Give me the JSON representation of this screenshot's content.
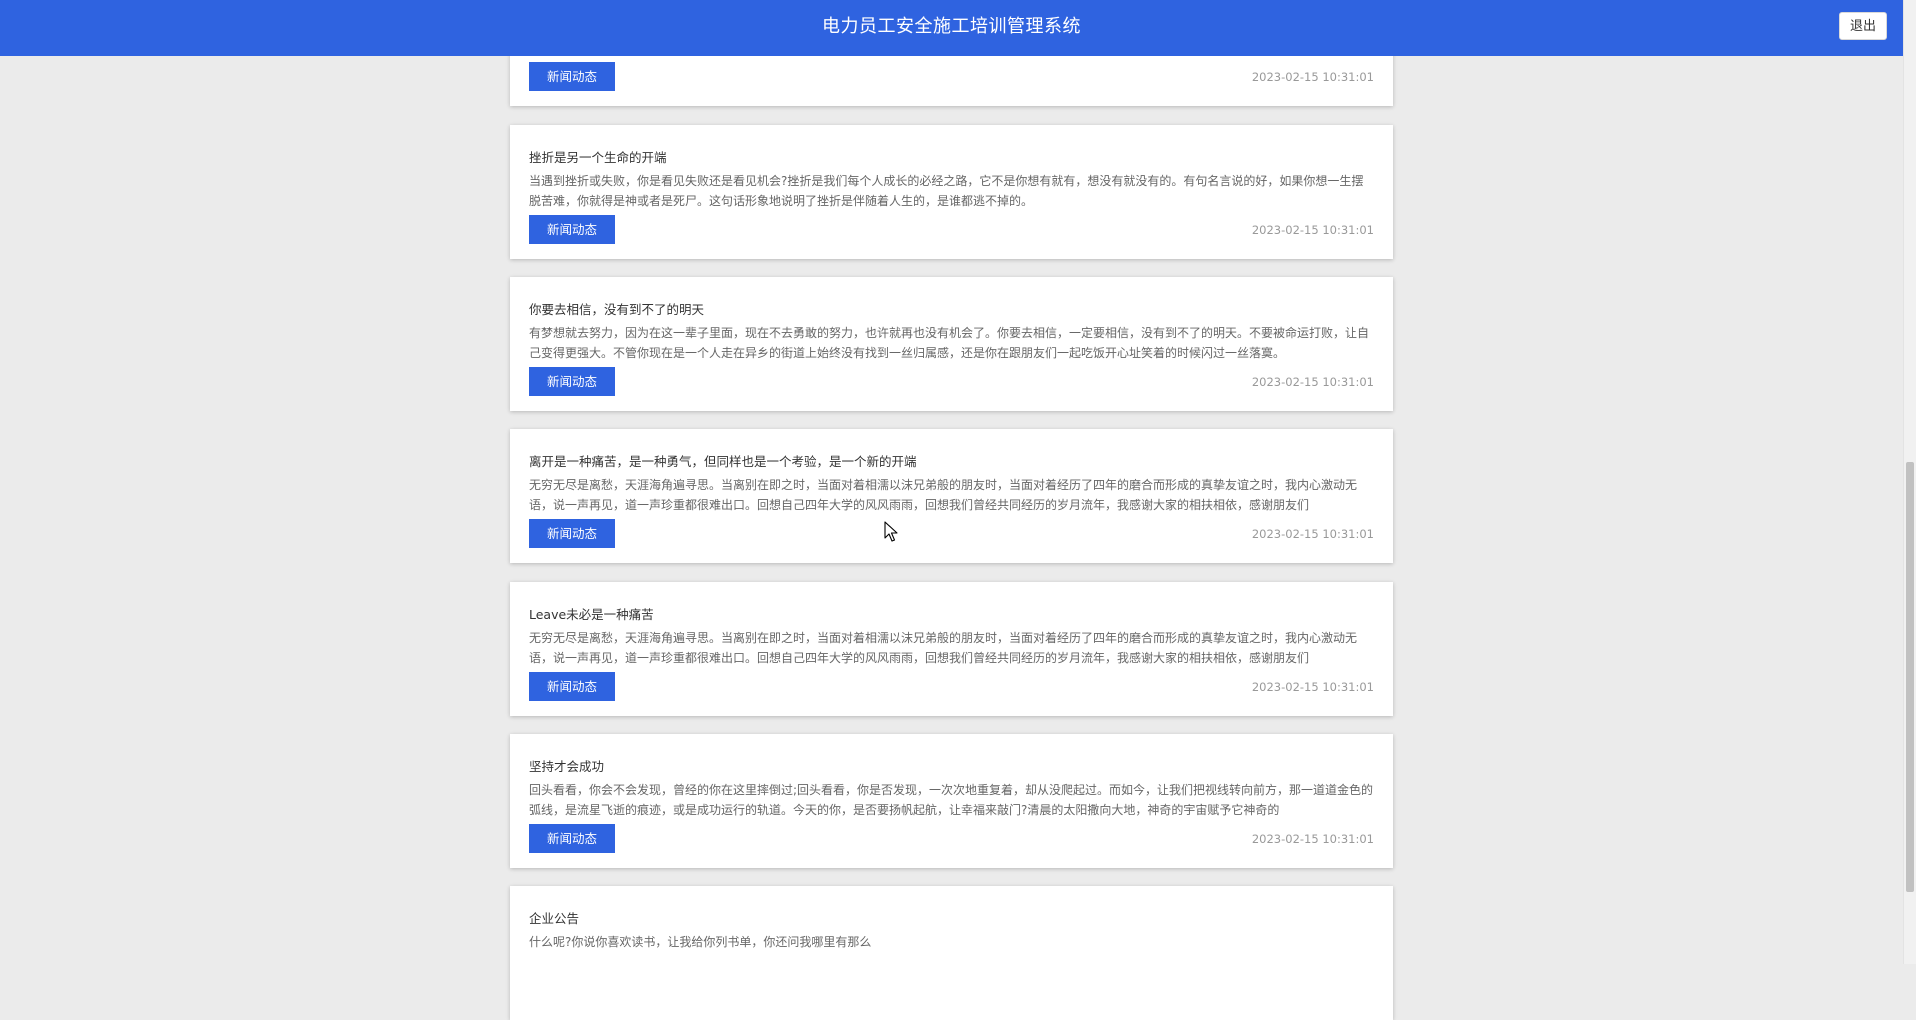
{
  "header": {
    "title": "电力员工安全施工培训管理系统",
    "logout_label": "退出"
  },
  "news": [
    {
      "title": "",
      "body": "",
      "tag": "新闻动态",
      "date": "2023-02-15 10:31:01"
    },
    {
      "title": "挫折是另一个生命的开端",
      "body": "当遇到挫折或失败，你是看见失败还是看见机会?挫折是我们每个人成长的必经之路，它不是你想有就有，想没有就没有的。有句名言说的好，如果你想一生摆脱苦难，你就得是神或者是死尸。这句话形象地说明了挫折是伴随着人生的，是谁都逃不掉的。",
      "tag": "新闻动态",
      "date": "2023-02-15 10:31:01"
    },
    {
      "title": "你要去相信，没有到不了的明天",
      "body": "有梦想就去努力，因为在这一辈子里面，现在不去勇敢的努力，也许就再也没有机会了。你要去相信，一定要相信，没有到不了的明天。不要被命运打败，让自己变得更强大。不管你现在是一个人走在异乡的街道上始终没有找到一丝归属感，还是你在跟朋友们一起吃饭开心址笑着的时候闪过一丝落寞。",
      "tag": "新闻动态",
      "date": "2023-02-15 10:31:01"
    },
    {
      "title": "离开是一种痛苦，是一种勇气，但同样也是一个考验，是一个新的开端",
      "body": "无穷无尽是离愁，天涯海角遍寻思。当离别在即之时，当面对着相濡以沫兄弟般的朋友时，当面对着经历了四年的磨合而形成的真挚友谊之时，我内心激动无语，说一声再见，道一声珍重都很难出口。回想自己四年大学的风风雨雨，回想我们曾经共同经历的岁月流年，我感谢大家的相扶相依，感谢朋友们",
      "tag": "新闻动态",
      "date": "2023-02-15 10:31:01"
    },
    {
      "title": "Leave未必是一种痛苦",
      "body": "无穷无尽是离愁，天涯海角遍寻思。当离别在即之时，当面对着相濡以沫兄弟般的朋友时，当面对着经历了四年的磨合而形成的真挚友谊之时，我内心激动无语，说一声再见，道一声珍重都很难出口。回想自己四年大学的风风雨雨，回想我们曾经共同经历的岁月流年，我感谢大家的相扶相依，感谢朋友们",
      "tag": "新闻动态",
      "date": "2023-02-15 10:31:01"
    },
    {
      "title": "坚持才会成功",
      "body": "回头看看，你会不会发现，曾经的你在这里摔倒过;回头看看，你是否发现，一次次地重复着，却从没爬起过。而如今，让我们把视线转向前方，那一道道金色的弧线，是流星飞逝的痕迹，或是成功运行的轨道。今天的你，是否要扬帆起航，让幸福来敲门?清晨的太阳撒向大地，神奇的宇宙赋予它神奇的",
      "tag": "新闻动态",
      "date": "2023-02-15 10:31:01"
    },
    {
      "title": "企业公告",
      "body": "什么呢?你说你喜欢读书，让我给你列书单，你还问我哪里有那么",
      "tag": "",
      "date": ""
    }
  ]
}
